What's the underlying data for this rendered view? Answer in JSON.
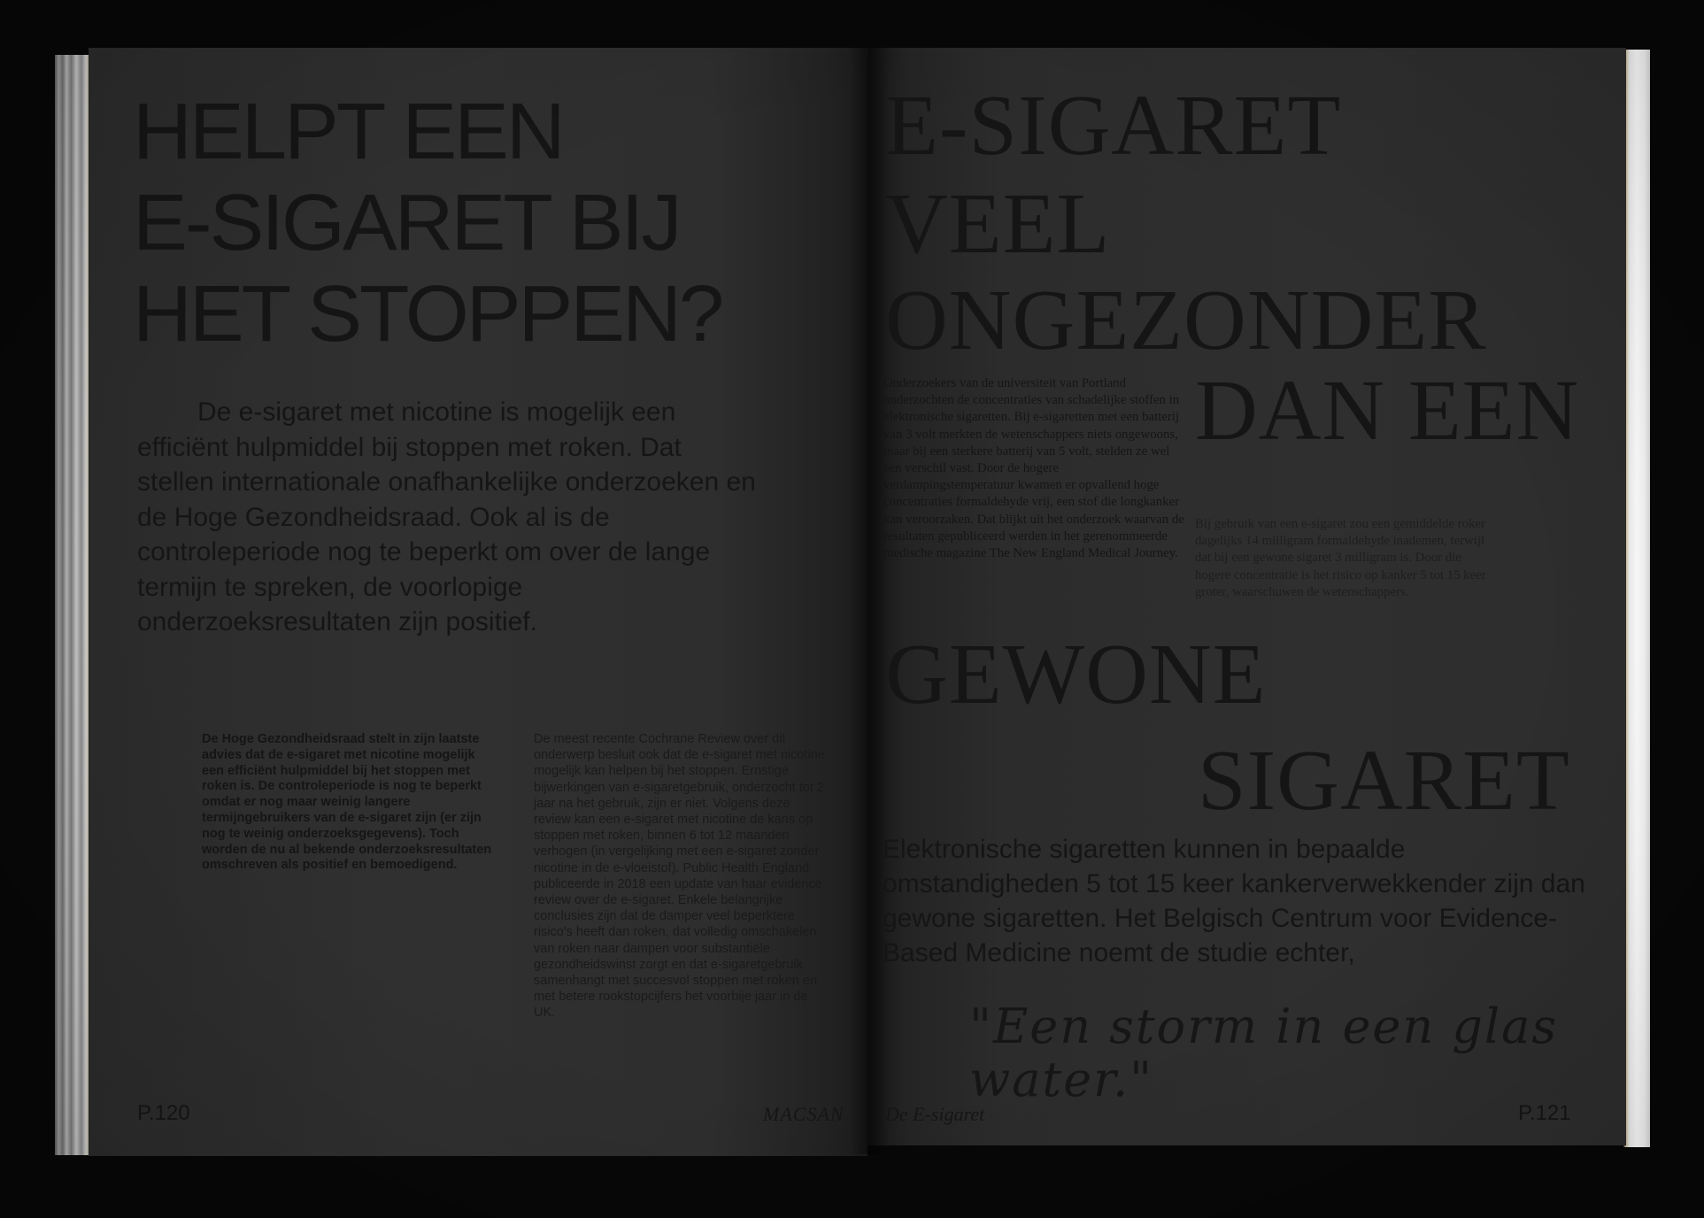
{
  "left_page": {
    "title_lines": [
      "HELPT EEN",
      "E-SIGARET BIJ",
      "HET STOPPEN?"
    ],
    "intro": "De e-sigaret met nicotine is mogelijk een efficiënt hulpmiddel bij stoppen met roken. Dat stellen internationale onafhankelijke onderzoeken en de Hoge Gezondheidsraad. Ook al is de controleperiode nog te beperkt om over de lange termijn te spreken, de voorlopige onderzoeksresultaten zijn positief.",
    "column1": "De Hoge Gezondheidsraad stelt in zijn laatste advies dat de e-sigaret met nicotine mogelijk een efficiënt hulpmiddel bij het stoppen met roken is. De controleperiode is nog te beperkt omdat er nog maar weinig langere termijngebruikers van de e-sigaret zijn (er zijn nog te weinig onderzoeksgegevens). Toch worden de nu al bekende onderzoeksresultaten omschreven als positief en bemoedigend.",
    "column2": "De meest recente Cochrane Review over dit onderwerp besluit ook dat de e-sigaret met nicotine mogelijk kan helpen bij het stoppen. Ernstige bijwerkingen van e-sigaretgebruik, onderzocht tot 2 jaar na het gebruik, zijn er niet. Volgens deze review kan een e-sigaret met nicotine de kans op stoppen met roken, binnen 6 tot 12 maanden verhogen (in vergelijking met een e-sigaret zonder nicotine in de e-vloeistof). Public Health England publiceerde in 2018 een update van haar evidence review over de e-sigaret. Enkele belangrijke conclusies zijn dat de damper veel beperktere risico's heeft dan roken, dat volledig omschakelen van roken naar dampen voor substantiële gezondheidswinst zorgt en dat e-sigaretgebruik samenhangt met succesvol stoppen met roken en met betere rookstopcijfers het voorbije jaar in de UK.",
    "folio": "P.120",
    "running_head": "MACSAN"
  },
  "right_page": {
    "headline": {
      "line1": "E-SIGARET",
      "line2": "VEEL",
      "line3": "ONGEZONDER",
      "line4": "DAN EEN",
      "line5": "GEWONE",
      "line6": "SIGARET"
    },
    "column1": "Onderzoekers van de universiteit van Portland onderzochten de concentraties van schadelijke stoffen in elektronische sigaretten. Bij e-sigaretten met een batterij van 3 volt merkten de wetenschappers niets ongewoons, maar bij een sterkere batterij van 5 volt, stelden ze wel een verschil vast. Door de hogere verdampingstemperatuur kwamen er opvallend hoge concentraties formaldehyde vrij, een stof die longkanker kan veroorzaken. Dat blijkt uit het onderzoek waarvan de resultaten gepubliceerd werden in het gerenommeerde medische magazine The New England Medical Journey.",
    "column2": "Bij gebruik van een e-sigaret zou een gemiddelde roker dagelijks 14 milligram formaldehyde inademen, terwijl dat bij een gewone sigaret 3 milligram is. Door die hogere concentratie is het risico op kanker 5 tot 15 keer groter, waarschuwen de wetenschappers.",
    "lead": "Elektronische sigaretten kunnen in bepaalde omstandigheden 5 tot 15 keer kankerverwekkender zijn dan gewone sigaretten. Het Belgisch Centrum voor Evidence-Based Medicine noemt de studie echter,",
    "quote": "\"Een storm in een glas water.\"",
    "running_head": "De E-sigaret",
    "folio": "P.121"
  }
}
